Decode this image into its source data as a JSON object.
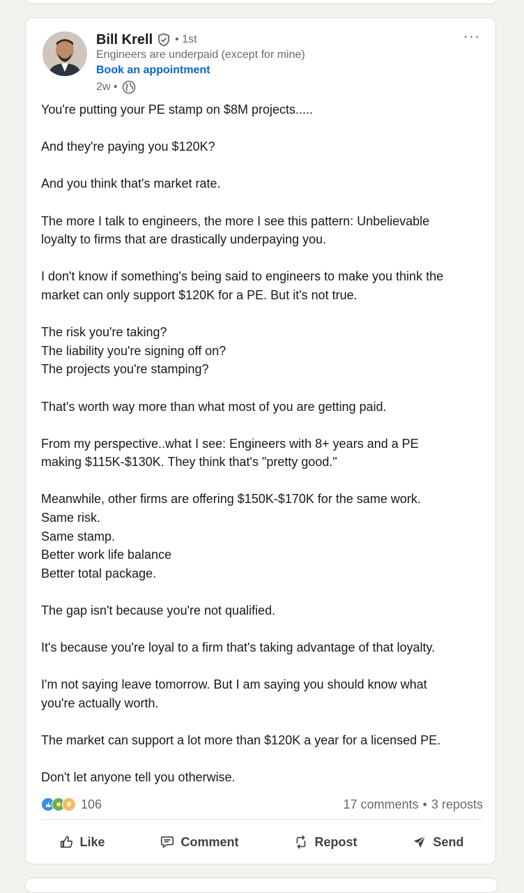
{
  "post": {
    "author": {
      "name": "Bill Krell",
      "degree": "• 1st",
      "headline": "Engineers are underpaid (except for mine)",
      "cta": "Book an appointment",
      "time": "2w •"
    },
    "more_label": "···",
    "paragraphs": [
      [
        "You're putting your PE stamp on $8M projects....."
      ],
      [
        "And they're paying you $120K?"
      ],
      [
        "And you think that's market rate."
      ],
      [
        "The more I talk to engineers, the more I see this pattern: Unbelievable",
        "loyalty to firms that are drastically underpaying you."
      ],
      [
        "I don't know if something's being said to engineers to make you think the",
        "market can only support $120K for a PE. But it's not true."
      ],
      [
        "The risk you're taking?",
        "The liability you're signing off on?",
        "The projects you're stamping?"
      ],
      [
        "That's worth way more than what most of you are getting paid."
      ],
      [
        "From my perspective..what I see: Engineers with 8+ years and a PE",
        "making $115K-$130K. They think that's \"pretty good.\""
      ],
      [
        "Meanwhile, other firms are offering $150K-$170K for the same work.",
        "Same risk.",
        "Same stamp.",
        "Better work life balance",
        "Better total package."
      ],
      [
        "The gap isn't because you're not qualified."
      ],
      [
        "It's because you're loyal to a firm that's taking advantage of that loyalty."
      ],
      [
        "I'm not saying leave tomorrow. But I am saying you should know what",
        "you're actually worth."
      ],
      [
        "The market can support a lot more than $120K a year for a licensed PE."
      ],
      [
        "Don't let anyone tell you otherwise."
      ]
    ],
    "reactions": {
      "count": "106",
      "types": [
        "like",
        "celebrate",
        "insightful"
      ],
      "colors": {
        "like": "#378fe9",
        "celebrate": "#6dae4f",
        "insightful": "#f5bb5c"
      }
    },
    "comments": "17 comments",
    "separator": "•",
    "reposts": "3 reposts",
    "actions": {
      "like": "Like",
      "comment": "Comment",
      "repost": "Repost",
      "send": "Send"
    }
  },
  "colors": {
    "accent": "#0a66c2",
    "text": "#000000e6",
    "muted": "#00000099",
    "background": "#f4f2ee"
  }
}
